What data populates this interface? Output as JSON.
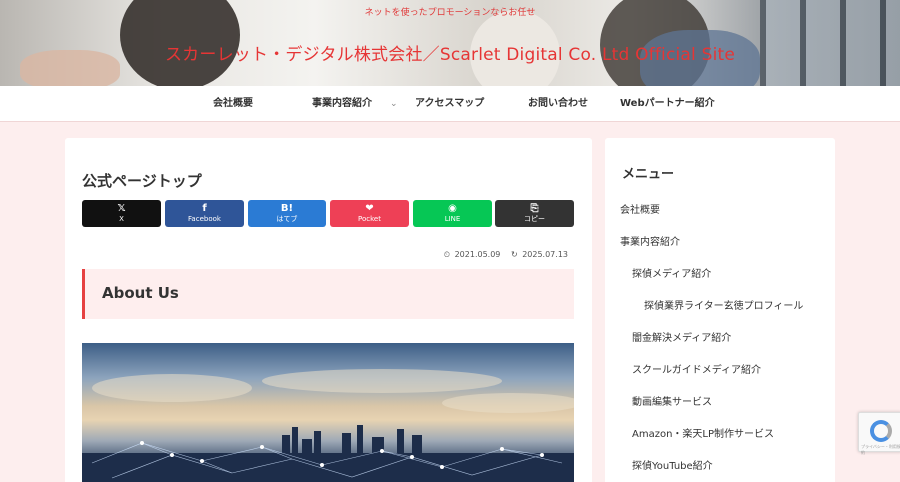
{
  "header": {
    "tagline": "ネットを使ったプロモーションならお任せ",
    "site_title": "スカーレット・デジタル株式会社／Scarlet Digital Co. Ltd Official Site"
  },
  "nav": {
    "items": [
      {
        "label": "会社概要"
      },
      {
        "label": "事業内容紹介",
        "has_dropdown": true
      },
      {
        "label": "アクセスマップ"
      },
      {
        "label": "お問い合わせ"
      },
      {
        "label": "Webパートナー紹介"
      }
    ],
    "chevron": "⌄"
  },
  "main": {
    "page_title": "公式ページトップ",
    "share_buttons": [
      {
        "icon": "𝕏",
        "label": "X",
        "color": "#111111"
      },
      {
        "icon": "f",
        "label": "Facebook",
        "color": "#2f5598"
      },
      {
        "icon": "B!",
        "label": "はてブ",
        "color": "#2b7bd4"
      },
      {
        "icon": "❤",
        "label": "Pocket",
        "color": "#ee4056"
      },
      {
        "icon": "◉",
        "label": "LINE",
        "color": "#06c755"
      },
      {
        "icon": "⎘",
        "label": "コピー",
        "color": "#333333"
      }
    ],
    "published_icon": "⏲",
    "published_date": "2021.05.09",
    "updated_icon": "↻",
    "updated_date": "2025.07.13",
    "section_heading": "About Us"
  },
  "sidebar": {
    "title": "メニュー",
    "items": [
      {
        "label": "会社概要",
        "level": 0
      },
      {
        "label": "事業内容紹介",
        "level": 0
      },
      {
        "label": "探偵メディア紹介",
        "level": 1
      },
      {
        "label": "探偵業界ライター玄徳プロフィール",
        "level": 2
      },
      {
        "label": "闇金解決メディア紹介",
        "level": 1
      },
      {
        "label": "スクールガイドメディア紹介",
        "level": 1
      },
      {
        "label": "動画編集サービス",
        "level": 1
      },
      {
        "label": "Amazon・楽天LP制作サービス",
        "level": 1
      },
      {
        "label": "探偵YouTube紹介",
        "level": 1
      }
    ]
  },
  "recaptcha": {
    "text": "プライバシー・利用規約"
  },
  "colors": {
    "accent": "#e63535",
    "page_bg": "#fdeeee",
    "heading_bg": "#feeeee"
  }
}
